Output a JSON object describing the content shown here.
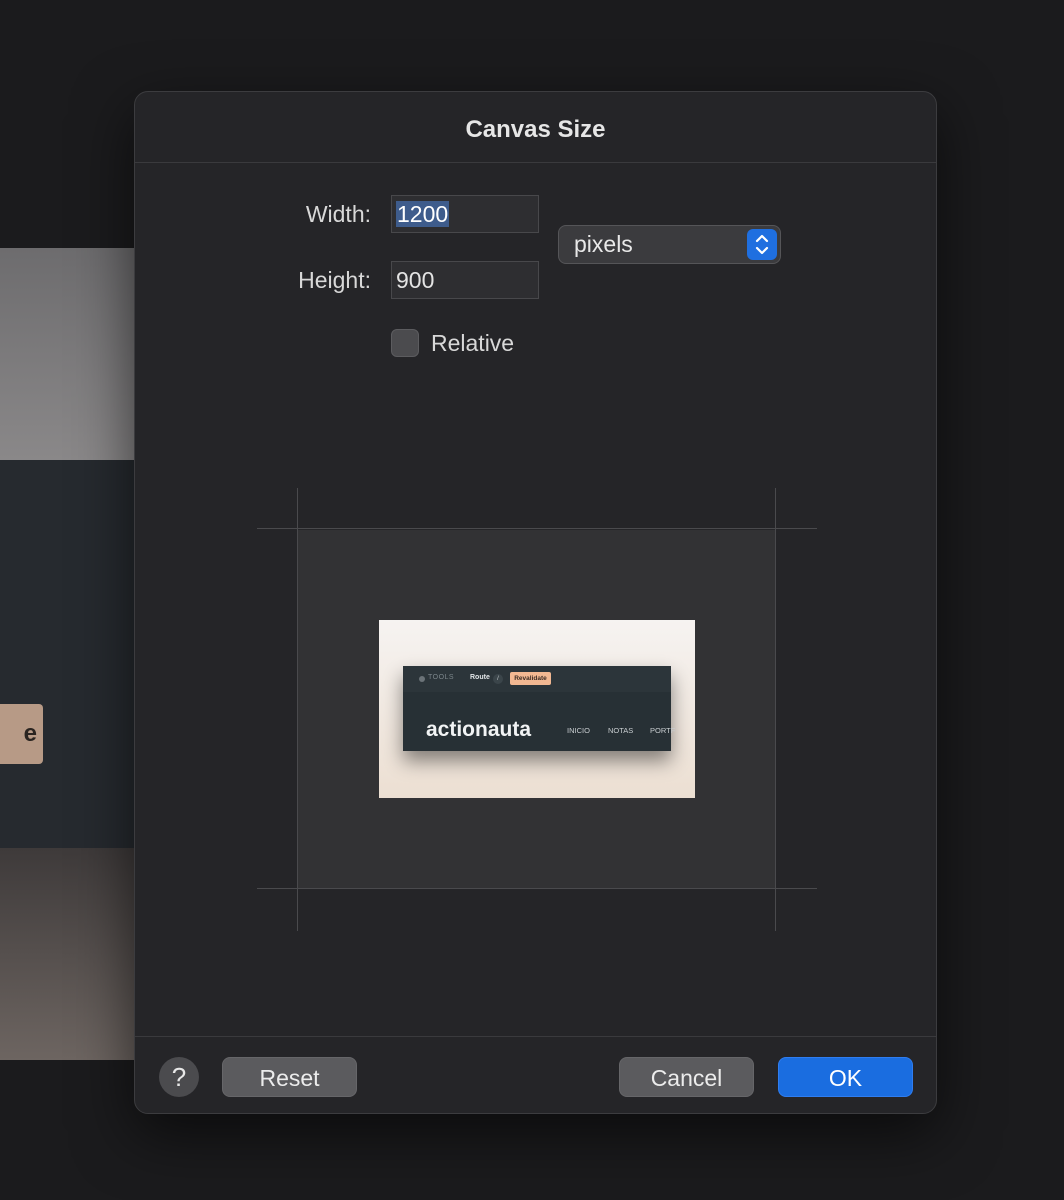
{
  "background": {
    "partial_button_text": "e"
  },
  "dialog": {
    "title": "Canvas Size",
    "width_label": "Width:",
    "width_value": "1200",
    "height_label": "Height:",
    "height_value": "900",
    "unit_value": "pixels",
    "relative_label": "Relative",
    "relative_checked": false
  },
  "preview": {
    "tools_label": "TOOLS",
    "route_label": "Route",
    "slash_label": "/",
    "revalidate_label": "Revalidate",
    "brand": "actionauta",
    "nav": [
      "INICIO",
      "NOTAS",
      "PORTF"
    ]
  },
  "footer": {
    "help_label": "?",
    "reset_label": "Reset",
    "cancel_label": "Cancel",
    "ok_label": "OK"
  },
  "colors": {
    "accent": "#1a6de0",
    "dialog_bg": "#252528",
    "revalidate_badge": "#f2b892"
  },
  "icons": [
    "chevron-up-down-icon",
    "help-icon",
    "grip-handle-icon"
  ]
}
